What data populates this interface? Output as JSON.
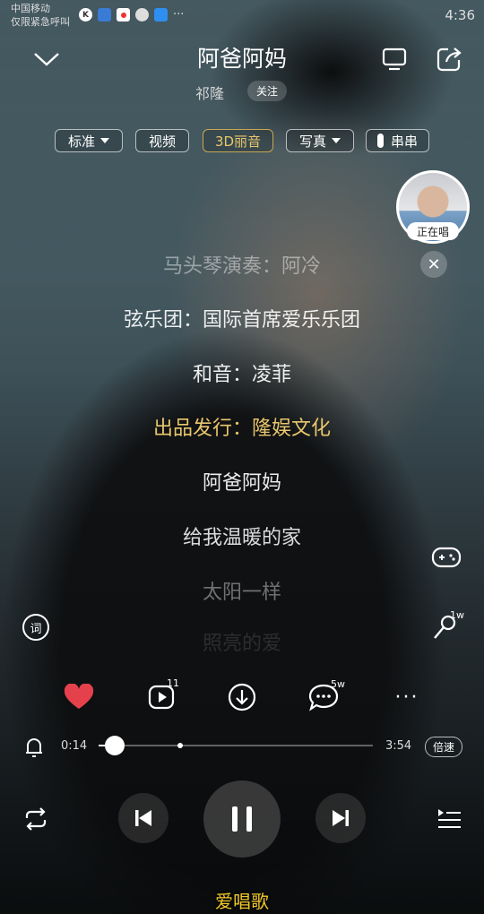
{
  "status": {
    "carrier": "中国移动",
    "emergency": "仅限紧急呼叫",
    "time": "4:36"
  },
  "header": {
    "title": "阿爸阿妈",
    "artist": "祁隆",
    "follow_label": "关注"
  },
  "options": {
    "quality": "标准",
    "video": "视频",
    "sound_3d": "3D丽音",
    "portrait": "写真",
    "chuanchuan": "串串"
  },
  "live": {
    "label": "正在唱"
  },
  "lyrics": [
    "马头琴演奏：阿冷",
    "弦乐团：国际首席爱乐乐团",
    "和音：凌菲",
    "出品发行：隆娱文化",
    "阿爸阿妈",
    "给我温暖的家",
    "太阳一样",
    "照亮的爱"
  ],
  "side": {
    "lyric_toggle": "词",
    "sing_count": "1w"
  },
  "actions": {
    "recognition_count": "11",
    "comment_count": "5w"
  },
  "progress": {
    "current": "0:14",
    "total": "3:54",
    "fraction": 0.06,
    "speed_label": "倍速"
  },
  "watermark": "爱唱歌",
  "colors": {
    "gold": "#e8c66c",
    "heart": "#e5414c",
    "watermark": "#f0c82a"
  }
}
